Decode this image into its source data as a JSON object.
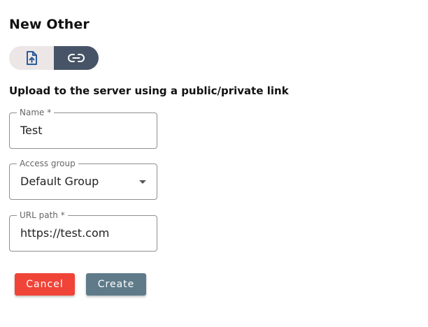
{
  "header": {
    "title": "New Other"
  },
  "mode_toggle": {
    "options": [
      {
        "icon": "file-upload-icon",
        "selected": false
      },
      {
        "icon": "link-icon",
        "selected": true
      }
    ]
  },
  "form": {
    "subtitle": "Upload to the server using a public/private link",
    "name": {
      "label": "Name *",
      "value": "Test"
    },
    "access_group": {
      "label": "Access group",
      "value": "Default Group"
    },
    "url_path": {
      "label": "URL path *",
      "value": "https://test.com"
    }
  },
  "actions": {
    "cancel_label": "Cancel",
    "create_label": "Create"
  },
  "colors": {
    "cancel": "#f04438",
    "create": "#5f7b8a",
    "toggle_selected": "#475467",
    "toggle_unselected": "#ece6e6"
  }
}
